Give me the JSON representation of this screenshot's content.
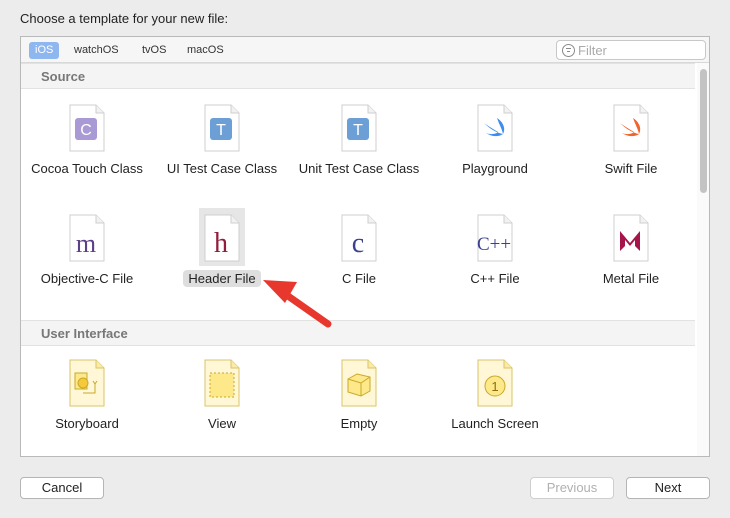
{
  "dialog": {
    "title": "Choose a template for your new file:"
  },
  "platform_tabs": [
    {
      "label": "iOS",
      "selected": true
    },
    {
      "label": "watchOS",
      "selected": false
    },
    {
      "label": "tvOS",
      "selected": false
    },
    {
      "label": "macOS",
      "selected": false
    }
  ],
  "filter": {
    "placeholder": "Filter",
    "value": ""
  },
  "sections": [
    {
      "title": "Source",
      "templates": [
        {
          "label": "Cocoa Touch Class",
          "icon": "cocoa-touch-class-icon",
          "glyph": "C"
        },
        {
          "label": "UI Test Case Class",
          "icon": "ui-test-case-class-icon",
          "glyph": "T"
        },
        {
          "label": "Unit Test Case Class",
          "icon": "unit-test-case-class-icon",
          "glyph": "T"
        },
        {
          "label": "Playground",
          "icon": "playground-icon"
        },
        {
          "label": "Swift File",
          "icon": "swift-file-icon"
        },
        {
          "label": "Objective-C File",
          "icon": "objective-c-file-icon",
          "glyph": "m"
        },
        {
          "label": "Header File",
          "icon": "header-file-icon",
          "glyph": "h",
          "selected": true
        },
        {
          "label": "C File",
          "icon": "c-file-icon",
          "glyph": "c"
        },
        {
          "label": "C++ File",
          "icon": "cpp-file-icon",
          "glyph": "C++"
        },
        {
          "label": "Metal File",
          "icon": "metal-file-icon",
          "glyph": "M"
        }
      ]
    },
    {
      "title": "User Interface",
      "templates": [
        {
          "label": "Storyboard",
          "icon": "storyboard-icon"
        },
        {
          "label": "View",
          "icon": "view-icon"
        },
        {
          "label": "Empty",
          "icon": "empty-icon"
        },
        {
          "label": "Launch Screen",
          "icon": "launch-screen-icon",
          "glyph": "1"
        }
      ]
    }
  ],
  "buttons": {
    "cancel": "Cancel",
    "previous": "Previous",
    "next": "Next"
  },
  "colors": {
    "selected_tab": "#8eb7f0",
    "annotation_arrow": "#e8372c"
  }
}
